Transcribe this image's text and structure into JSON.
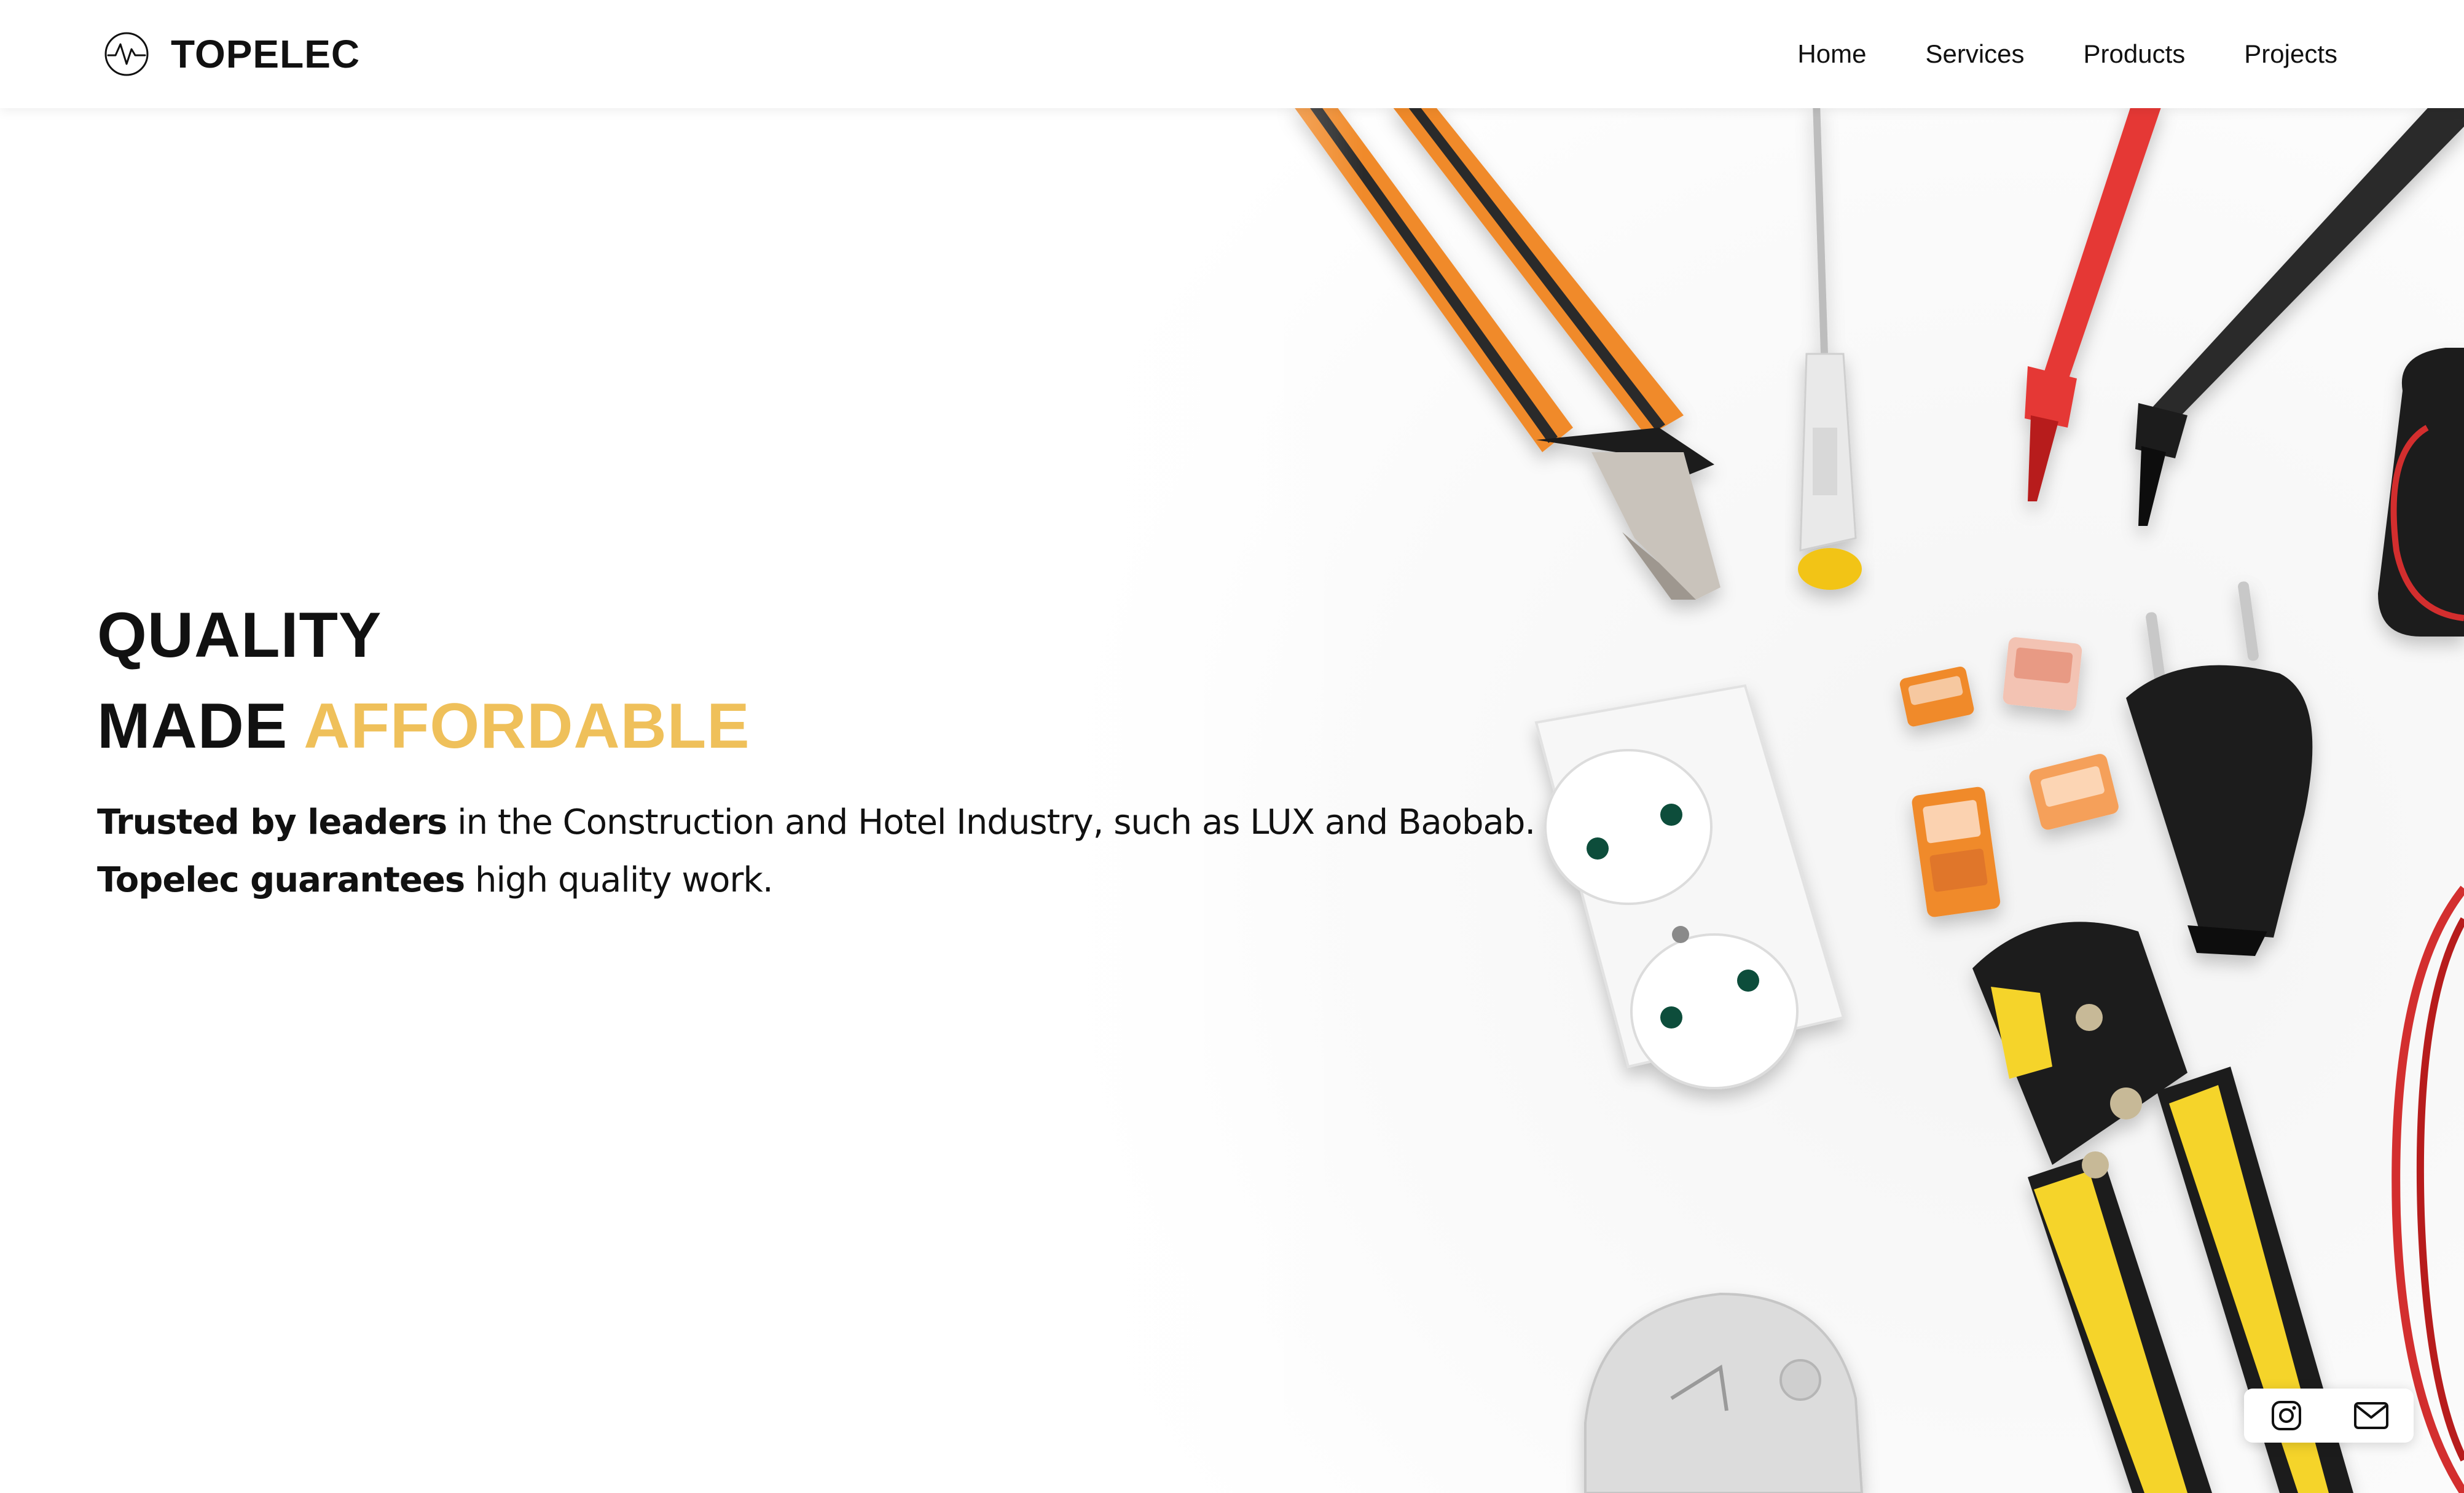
{
  "header": {
    "brand_name": "TOPELEC",
    "logo_icon": "pulse-wave-icon",
    "nav": [
      {
        "label": "Home"
      },
      {
        "label": "Services"
      },
      {
        "label": "Products"
      },
      {
        "label": "Projects"
      }
    ]
  },
  "hero": {
    "headline_line1": "QUALITY",
    "headline_line2_plain": "MADE",
    "headline_line2_accent": "AFFORDABLE",
    "tagline_1_bold": "Trusted by leaders",
    "tagline_1_rest": " in the Construction and Hotel Industry, such as LUX and Baobab.",
    "tagline_2_bold": "Topelec guarantees",
    "tagline_2_rest": " high quality work."
  },
  "social": {
    "instagram_icon": "instagram-icon",
    "mail_icon": "mail-icon"
  },
  "colors": {
    "accent": "#EFC05A",
    "text": "#111111",
    "background": "#FFFFFF"
  }
}
